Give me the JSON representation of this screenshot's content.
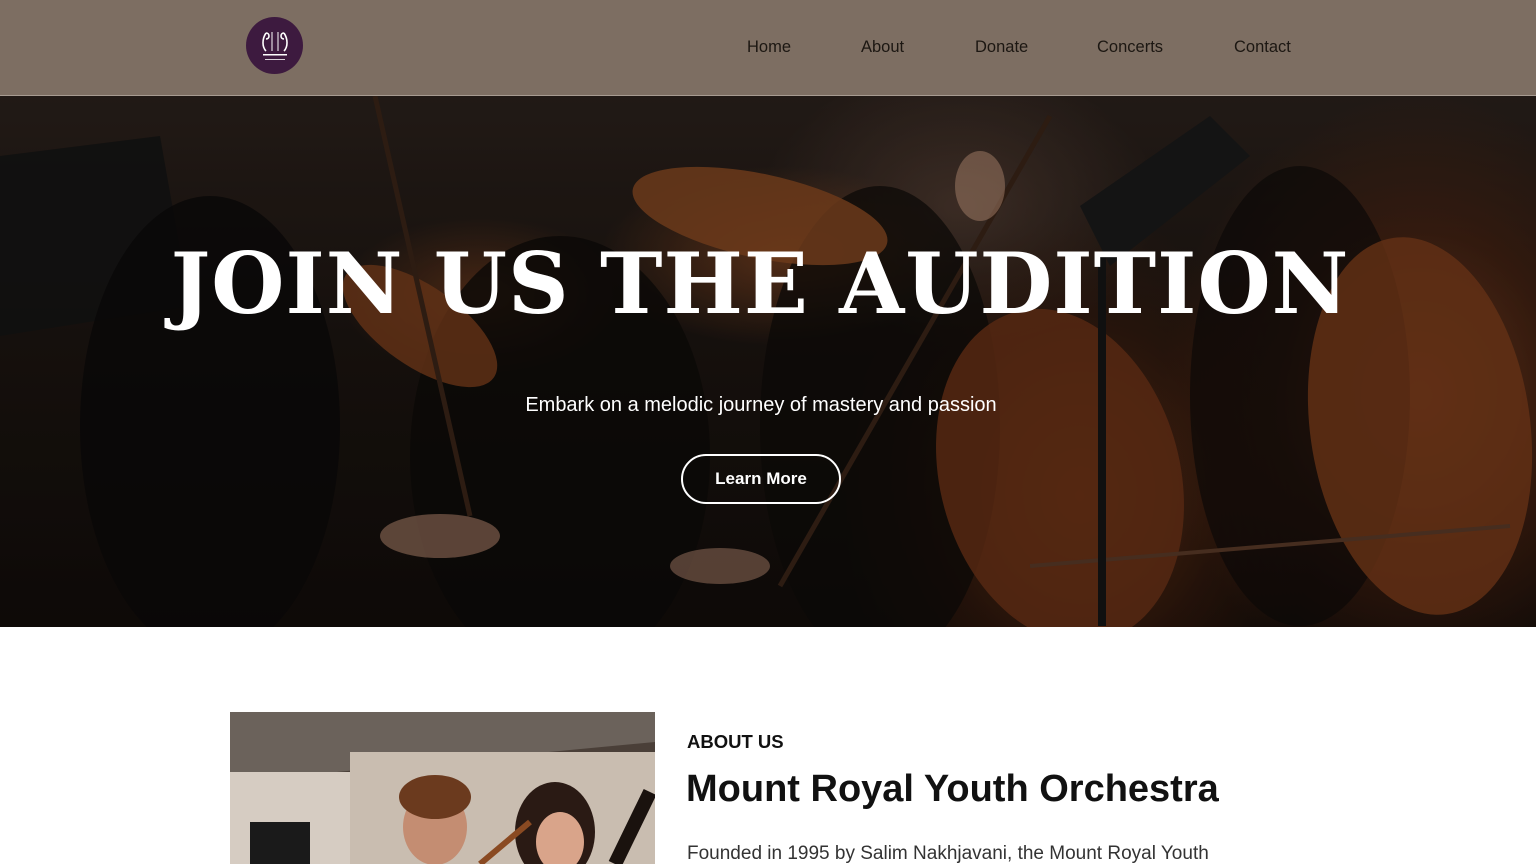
{
  "header": {
    "logo": {
      "icon": "violin-scroll-logo-icon",
      "color": "#3d1a3f"
    },
    "background_color": "#7d6e62",
    "nav": [
      {
        "label": "Home"
      },
      {
        "label": "About"
      },
      {
        "label": "Donate"
      },
      {
        "label": "Concerts"
      },
      {
        "label": "Contact"
      }
    ]
  },
  "hero": {
    "title": "JOIN US THE AUDITION",
    "subtitle": "Embark on a melodic journey of mastery and passion",
    "button_label": "Learn More",
    "background_image": "orchestra-string-players-photo"
  },
  "about": {
    "kicker": "ABOUT US",
    "heading": "Mount Royal Youth Orchestra",
    "text": "Founded in 1995 by Salim Nakhjavani, the Mount Royal Youth",
    "image": "young-violinists-performing-photo"
  }
}
